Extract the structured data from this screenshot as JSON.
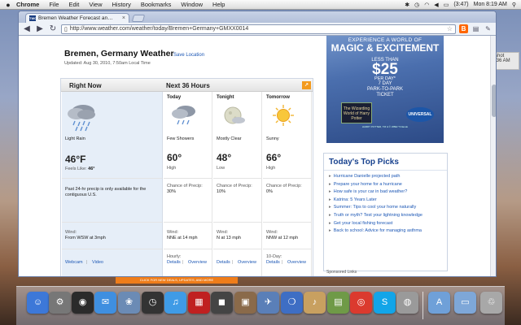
{
  "menubar": {
    "app": "Chrome",
    "items": [
      "File",
      "Edit",
      "View",
      "History",
      "Bookmarks",
      "Window",
      "Help"
    ],
    "battery": "(3:47)",
    "clock": "Mon 8:19 AM"
  },
  "desktop": {
    "file_label": "shot",
    "file_time": ".36 AM"
  },
  "browser": {
    "tab_title": "Bremen Weather Forecast an…",
    "tab_favicon": "TWC",
    "url": "http://www.weather.com/weather/today/Bremen+Germany+GMXX0014"
  },
  "page": {
    "title": "Bremen, Germany Weather",
    "save_location": "Save Location",
    "updated": "Updated: Aug 30, 2010, 7:50am Local Time",
    "right_now_header": "Right Now",
    "next36_header": "Next 36 Hours",
    "right_now": {
      "condition": "Light Rain",
      "temp": "46°F",
      "feels_like_label": "Feels Like:",
      "feels_like_value": "46°",
      "precip_note": "Past 24-hr precip is only available for the contiguous U.S.",
      "wind_label": "Wind:",
      "wind_value": "From WSW at 3mph",
      "link_webcam": "Webcam",
      "link_sep": "|",
      "link_video": "Video"
    },
    "forecast": [
      {
        "period": "Today",
        "icon": "showers-icon",
        "condition": "Few Showers",
        "temp": "60°",
        "temp_label": "High",
        "precip_label": "Chance of Precip:",
        "precip": "30%",
        "wind_label": "Wind:",
        "wind": "NNE at 14 mph",
        "footer_label": "Hourly:",
        "link_a": "Details",
        "link_sep": "|",
        "link_b": "Overview"
      },
      {
        "period": "Tonight",
        "icon": "mostly-clear-night-icon",
        "condition": "Mostly Clear",
        "temp": "48°",
        "temp_label": "Low",
        "precip_label": "Chance of Precip:",
        "precip": "10%",
        "wind_label": "Wind:",
        "wind": "N at 13 mph",
        "footer_label": "",
        "link_a": "Details",
        "link_sep": "|",
        "link_b": "Overview"
      },
      {
        "period": "Tomorrow",
        "icon": "sunny-icon",
        "condition": "Sunny",
        "temp": "66°",
        "temp_label": "High",
        "precip_label": "Chance of Precip:",
        "precip": "0%",
        "wind_label": "Wind:",
        "wind": "NNW at 12 mph",
        "footer_label": "10-Day:",
        "link_a": "Details",
        "link_sep": "|",
        "link_b": "Overview"
      }
    ],
    "ad": {
      "line1": "EXPERIENCE A WORLD OF",
      "line2": "MAGIC & EXCITEMENT",
      "line3": "LESS THAN",
      "price": "$25",
      "line5": "PER DAY*",
      "line6": "7 DAY",
      "line7": "PARK-TO-PARK",
      "line8": "TICKET",
      "harry_potter": "The Wizarding World of Harry Potter",
      "universal": "UNIVERSAL",
      "legal": "HARRY POTTER, TM & © WBEI *Orlando"
    },
    "top_picks": {
      "title": "Today's Top Picks",
      "items": [
        "Hurricane Danielle projected path",
        "Prepare your home for a hurricane",
        "How safe is your car in bad weather?",
        "Katrina: 5 Years Later",
        "Summer: Tips to cool your home naturally",
        "Truth or myth? Test your lightning knowledge",
        "Get your local fishing forecast",
        "Back to school: Advice for managing asthma"
      ]
    },
    "sponsored": "Sponsored Links",
    "promo_strip": "CLICK FOR NEW DEALS, UPDATES, AND MORE"
  },
  "dock": {
    "items": [
      {
        "name": "finder-icon",
        "glyph": "☺",
        "color": "#3d78d8"
      },
      {
        "name": "system-preferences-icon",
        "glyph": "⚙",
        "color": "#777777"
      },
      {
        "name": "itunes-alt-icon",
        "glyph": "◉",
        "color": "#2b2b2b"
      },
      {
        "name": "ichat-icon",
        "glyph": "✉",
        "color": "#3f8fe0"
      },
      {
        "name": "photo-icon",
        "glyph": "❀",
        "color": "#6b8bb5"
      },
      {
        "name": "dashboard-icon",
        "glyph": "◷",
        "color": "#333333"
      },
      {
        "name": "itunes-icon",
        "glyph": "♫",
        "color": "#3f9be6"
      },
      {
        "name": "front-row-icon",
        "glyph": "▦",
        "color": "#c02020"
      },
      {
        "name": "photo-booth-icon",
        "glyph": "◼",
        "color": "#444444"
      },
      {
        "name": "iphoto-icon",
        "glyph": "▣",
        "color": "#8a6a4a"
      },
      {
        "name": "preview-icon",
        "glyph": "✈",
        "color": "#5a7fb8"
      },
      {
        "name": "keynote-icon",
        "glyph": "❍",
        "color": "#3e6ec4"
      },
      {
        "name": "garageband-icon",
        "glyph": "♪",
        "color": "#c8a060"
      },
      {
        "name": "numbers-icon",
        "glyph": "▤",
        "color": "#6f9a47"
      },
      {
        "name": "chrome-icon",
        "glyph": "◎",
        "color": "#db3a2e"
      },
      {
        "name": "skype-icon",
        "glyph": "S",
        "color": "#12a5e8"
      },
      {
        "name": "dvd-player-icon",
        "glyph": "◍",
        "color": "#9a9a9a"
      },
      {
        "name": "applications-folder-icon",
        "glyph": "A",
        "color": "#6fa0d8"
      },
      {
        "name": "documents-folder-icon",
        "glyph": "▭",
        "color": "#7ea7d8"
      },
      {
        "name": "trash-icon",
        "glyph": "♲",
        "color": "#a8a8a8"
      }
    ]
  },
  "colors": {
    "link": "#1c57b5",
    "accent": "#f39a1e",
    "panel": "#e6eef8"
  }
}
